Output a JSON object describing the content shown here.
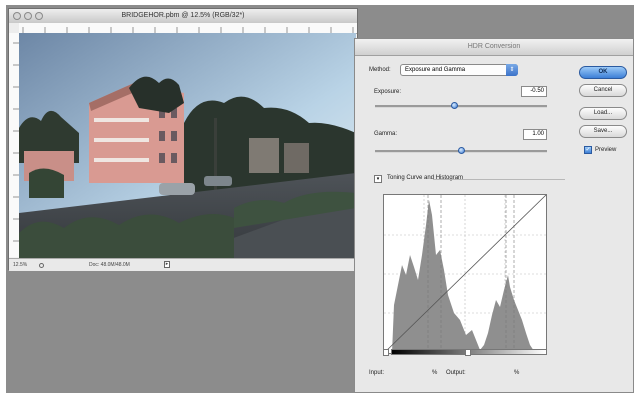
{
  "document": {
    "title": "BRIDGEHOR.pbm @ 12.5% (RGB/32*)",
    "status_zoom": "12.5%",
    "status_doc": "Doc: 48.0M/48.0M"
  },
  "dialog": {
    "title": "HDR Conversion",
    "method_label": "Method:",
    "method_value": "Exposure and Gamma",
    "exposure_label": "Exposure:",
    "exposure_value": "-0.50",
    "exposure_position": 0.46,
    "gamma_label": "Gamma:",
    "gamma_value": "1.00",
    "gamma_position": 0.5,
    "toning_label": "Toning Curve and Histogram",
    "input_label": "Input:",
    "input_unit": "%",
    "output_label": "Output:",
    "output_unit": "%",
    "buttons": {
      "ok": "OK",
      "cancel": "Cancel",
      "load": "Load...",
      "save": "Save..."
    },
    "preview_label": "Preview",
    "preview_checked": true
  },
  "colors": {
    "accent": "#3d7fd6",
    "workspace": "#8c8c8c",
    "histogram": "#8f8f8f"
  }
}
